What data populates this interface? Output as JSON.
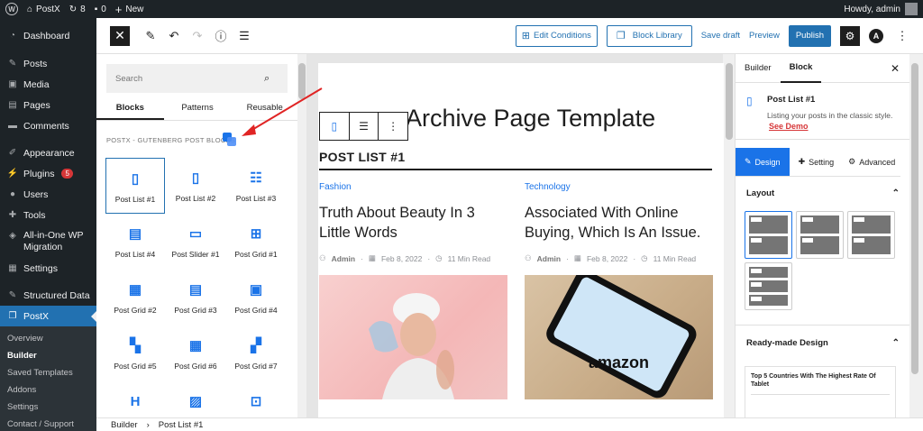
{
  "admin_bar": {
    "site_name": "PostX",
    "updates_count": "8",
    "comments_count": "0",
    "new_label": "New",
    "howdy": "Howdy, admin"
  },
  "admin_menu": {
    "items": [
      {
        "label": "Dashboard",
        "icon": "dashboard-icon"
      },
      {
        "label": "Posts",
        "icon": "pin-icon"
      },
      {
        "label": "Media",
        "icon": "media-icon"
      },
      {
        "label": "Pages",
        "icon": "pages-icon"
      },
      {
        "label": "Comments",
        "icon": "comment-icon"
      },
      {
        "label": "Appearance",
        "icon": "brush-icon"
      },
      {
        "label": "Plugins",
        "icon": "plug-icon",
        "badge": "5"
      },
      {
        "label": "Users",
        "icon": "user-icon"
      },
      {
        "label": "Tools",
        "icon": "wrench-icon"
      },
      {
        "label": "All-in-One WP Migration",
        "icon": "migration-icon"
      },
      {
        "label": "Settings",
        "icon": "settings-icon"
      },
      {
        "label": "Structured Data",
        "icon": "pin-icon"
      },
      {
        "label": "PostX",
        "icon": "postx-icon"
      }
    ],
    "submenu": [
      "Overview",
      "Builder",
      "Saved Templates",
      "Addons",
      "Settings",
      "Contact / Support"
    ]
  },
  "toolbar": {
    "edit_conditions": "Edit Conditions",
    "block_library": "Block Library",
    "save_draft": "Save draft",
    "preview": "Preview",
    "publish": "Publish"
  },
  "inserter": {
    "search_placeholder": "Search",
    "tabs": [
      "Blocks",
      "Patterns",
      "Reusable"
    ],
    "category_label": "POSTX - GUTENBERG POST BLOCKS",
    "blocks": [
      "Post List #1",
      "Post List #2",
      "Post List #3",
      "Post List #4",
      "Post Slider #1",
      "Post Grid #1",
      "Post Grid #2",
      "Post Grid #3",
      "Post Grid #4",
      "Post Grid #5",
      "Post Grid #6",
      "Post Grid #7",
      "",
      "",
      ""
    ]
  },
  "canvas": {
    "template_title": "Archive Page Template",
    "heading": "POST LIST #1",
    "posts": [
      {
        "category": "Fashion",
        "title": "Truth About Beauty In 3 Little Words",
        "author": "Admin",
        "date": "Feb 8, 2022",
        "read": "11 Min Read"
      },
      {
        "category": "Technology",
        "title": "Associated With Online Buying, Which Is An Issue.",
        "author": "Admin",
        "date": "Feb 8, 2022",
        "read": "11 Min Read",
        "image_text": "amazon"
      }
    ]
  },
  "sidebar": {
    "tabs": [
      "Builder",
      "Block"
    ],
    "block_name": "Post List #1",
    "block_desc": "Listing your posts in the classic style.",
    "demo_link": "See Demo",
    "settings_tabs": [
      "Design",
      "Setting",
      "Advanced"
    ],
    "layout_label": "Layout",
    "readymade_label": "Ready-made Design",
    "readymade_title": "Top 5 Countries With The Highest Rate Of Tablet"
  },
  "footer": {
    "crumbs": [
      "Builder",
      "Post List #1"
    ]
  },
  "colors": {
    "wp_blue": "#2271b1",
    "postx_blue": "#1a73e8",
    "admin_dark": "#1d2327",
    "arrow_red": "#e02424"
  }
}
